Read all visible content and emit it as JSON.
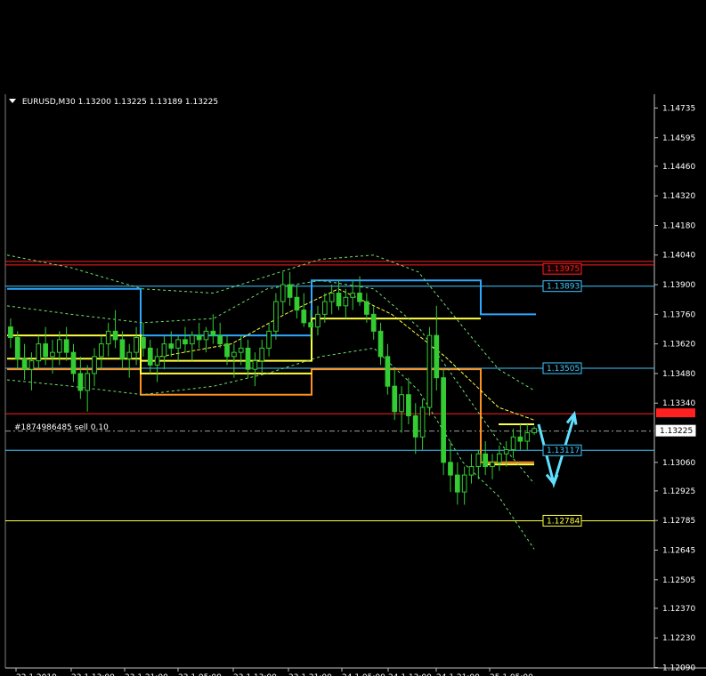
{
  "header": {
    "symbol": "EURUSD,M30",
    "open": "1.13200",
    "high": "1.13225",
    "low": "1.13189",
    "close": "1.13225"
  },
  "order": {
    "label": "#1874986485 sell 0.10"
  },
  "colors": {
    "background": "#000000",
    "bull": "#33cc33",
    "bear": "#33cc33",
    "red_line": "#ff2020",
    "cyan_line": "#40c8ff",
    "blue_step": "#2fa8ff",
    "yellow": "#ffff40",
    "orange": "#ff9020",
    "dashed_green": "#70e070",
    "arrow": "#60e0ff"
  },
  "chart_data": {
    "type": "candlestick",
    "ylim": [
      1.1205,
      1.148
    ],
    "yticks": [
      "1.14735",
      "1.14595",
      "1.14460",
      "1.14320",
      "1.14180",
      "1.14040",
      "1.13900",
      "1.13760",
      "1.13620",
      "1.13480",
      "1.13340",
      "1.13060",
      "1.12925",
      "1.12785",
      "1.12645",
      "1.12505",
      "1.12370",
      "1.12230",
      "1.12090"
    ],
    "xtick_labels": [
      "22.1 2019",
      "23.1 13:00",
      "23.1 21:00",
      "23.1 05:00",
      "23.1 13:00",
      "23.1 21:00",
      "24.1 05:00",
      "24.1 13:00",
      "24.1 21:00",
      "25.1 05:00"
    ],
    "current_price": "1.13225",
    "price_labels": [
      {
        "text": "1.13975",
        "value": 1.13975,
        "color": "red"
      },
      {
        "text": "1.13893",
        "value": 1.13893,
        "color": "cyan"
      },
      {
        "text": "1.13505",
        "value": 1.13505,
        "color": "cyan"
      },
      {
        "text": "1.13117",
        "value": 1.13117,
        "color": "cyan"
      },
      {
        "text": "1.12784",
        "value": 1.12784,
        "color": "yellow"
      }
    ],
    "horizontal_levels": [
      {
        "value": 1.1401,
        "color": "red"
      },
      {
        "value": 1.13993,
        "color": "red"
      },
      {
        "value": 1.13893,
        "color": "cyan"
      },
      {
        "value": 1.13505,
        "color": "cyan"
      },
      {
        "value": 1.1329,
        "color": "red"
      },
      {
        "value": 1.13117,
        "color": "cyan"
      },
      {
        "value": 1.12784,
        "color": "yellow"
      }
    ],
    "candles": [
      [
        1.137,
        1.1374,
        1.136,
        1.1365
      ],
      [
        1.1365,
        1.1368,
        1.135,
        1.1355
      ],
      [
        1.1355,
        1.1362,
        1.1345,
        1.135
      ],
      [
        1.135,
        1.1358,
        1.134,
        1.1354
      ],
      [
        1.1354,
        1.1366,
        1.135,
        1.1362
      ],
      [
        1.1362,
        1.137,
        1.1352,
        1.1356
      ],
      [
        1.1356,
        1.1364,
        1.1348,
        1.1358
      ],
      [
        1.1358,
        1.1368,
        1.1352,
        1.1364
      ],
      [
        1.1364,
        1.137,
        1.1354,
        1.1358
      ],
      [
        1.1358,
        1.1362,
        1.1344,
        1.1348
      ],
      [
        1.1348,
        1.1356,
        1.1336,
        1.134
      ],
      [
        1.134,
        1.1352,
        1.133,
        1.1348
      ],
      [
        1.1348,
        1.136,
        1.1342,
        1.1356
      ],
      [
        1.1356,
        1.1366,
        1.135,
        1.1362
      ],
      [
        1.1362,
        1.1372,
        1.1356,
        1.1368
      ],
      [
        1.1368,
        1.1378,
        1.136,
        1.1364
      ],
      [
        1.1364,
        1.1368,
        1.135,
        1.1355
      ],
      [
        1.1355,
        1.1362,
        1.1346,
        1.1358
      ],
      [
        1.1358,
        1.137,
        1.1352,
        1.1365
      ],
      [
        1.1365,
        1.1372,
        1.1356,
        1.136
      ],
      [
        1.136,
        1.1364,
        1.1348,
        1.1352
      ],
      [
        1.1352,
        1.136,
        1.1344,
        1.1356
      ],
      [
        1.1356,
        1.1366,
        1.135,
        1.1362
      ],
      [
        1.1362,
        1.1368,
        1.1356,
        1.136
      ],
      [
        1.136,
        1.1366,
        1.1354,
        1.1364
      ],
      [
        1.1364,
        1.137,
        1.1358,
        1.1362
      ],
      [
        1.1362,
        1.1368,
        1.1354,
        1.1366
      ],
      [
        1.1366,
        1.1372,
        1.136,
        1.1364
      ],
      [
        1.1364,
        1.137,
        1.1358,
        1.1368
      ],
      [
        1.1368,
        1.1376,
        1.1362,
        1.1366
      ],
      [
        1.1366,
        1.1372,
        1.136,
        1.1362
      ],
      [
        1.1362,
        1.1366,
        1.1352,
        1.1356
      ],
      [
        1.1356,
        1.1362,
        1.1346,
        1.1358
      ],
      [
        1.1358,
        1.1366,
        1.1352,
        1.136
      ],
      [
        1.136,
        1.1364,
        1.1346,
        1.135
      ],
      [
        1.135,
        1.1358,
        1.1342,
        1.1354
      ],
      [
        1.1354,
        1.1364,
        1.1348,
        1.136
      ],
      [
        1.136,
        1.1372,
        1.1356,
        1.1368
      ],
      [
        1.1368,
        1.1386,
        1.1364,
        1.1382
      ],
      [
        1.1382,
        1.1396,
        1.1376,
        1.139
      ],
      [
        1.139,
        1.1396,
        1.138,
        1.1384
      ],
      [
        1.1384,
        1.139,
        1.1374,
        1.1378
      ],
      [
        1.1378,
        1.1386,
        1.137,
        1.1372
      ],
      [
        1.1372,
        1.1378,
        1.1364,
        1.137
      ],
      [
        1.137,
        1.138,
        1.1366,
        1.1376
      ],
      [
        1.1376,
        1.1386,
        1.1372,
        1.1382
      ],
      [
        1.1382,
        1.139,
        1.1376,
        1.1386
      ],
      [
        1.1386,
        1.1392,
        1.1378,
        1.138
      ],
      [
        1.138,
        1.1388,
        1.1374,
        1.1384
      ],
      [
        1.1384,
        1.1392,
        1.1378,
        1.1386
      ],
      [
        1.1386,
        1.1394,
        1.138,
        1.1382
      ],
      [
        1.1382,
        1.1386,
        1.1372,
        1.1376
      ],
      [
        1.1376,
        1.138,
        1.1364,
        1.1368
      ],
      [
        1.1368,
        1.1372,
        1.1352,
        1.1356
      ],
      [
        1.1356,
        1.1362,
        1.1338,
        1.1342
      ],
      [
        1.1342,
        1.135,
        1.1326,
        1.133
      ],
      [
        1.133,
        1.1342,
        1.132,
        1.1338
      ],
      [
        1.1338,
        1.1346,
        1.1324,
        1.1328
      ],
      [
        1.1328,
        1.1334,
        1.131,
        1.1318
      ],
      [
        1.1318,
        1.1336,
        1.1312,
        1.1332
      ],
      [
        1.1332,
        1.137,
        1.1328,
        1.1366
      ],
      [
        1.1366,
        1.138,
        1.134,
        1.1346
      ],
      [
        1.1346,
        1.135,
        1.13,
        1.1306
      ],
      [
        1.1306,
        1.1316,
        1.1292,
        1.13
      ],
      [
        1.13,
        1.1306,
        1.1286,
        1.1292
      ],
      [
        1.1292,
        1.1304,
        1.1286,
        1.13
      ],
      [
        1.13,
        1.131,
        1.1296,
        1.1304
      ],
      [
        1.1304,
        1.1312,
        1.1298,
        1.131
      ],
      [
        1.131,
        1.1316,
        1.13,
        1.1304
      ],
      [
        1.1304,
        1.131,
        1.1298,
        1.1306
      ],
      [
        1.1306,
        1.1314,
        1.1302,
        1.131
      ],
      [
        1.131,
        1.1316,
        1.1304,
        1.1312
      ],
      [
        1.1312,
        1.1322,
        1.1308,
        1.1318
      ],
      [
        1.1318,
        1.1324,
        1.1312,
        1.1316
      ],
      [
        1.1316,
        1.1324,
        1.1312,
        1.132
      ],
      [
        1.132,
        1.1323,
        1.1319,
        1.1322
      ]
    ]
  }
}
